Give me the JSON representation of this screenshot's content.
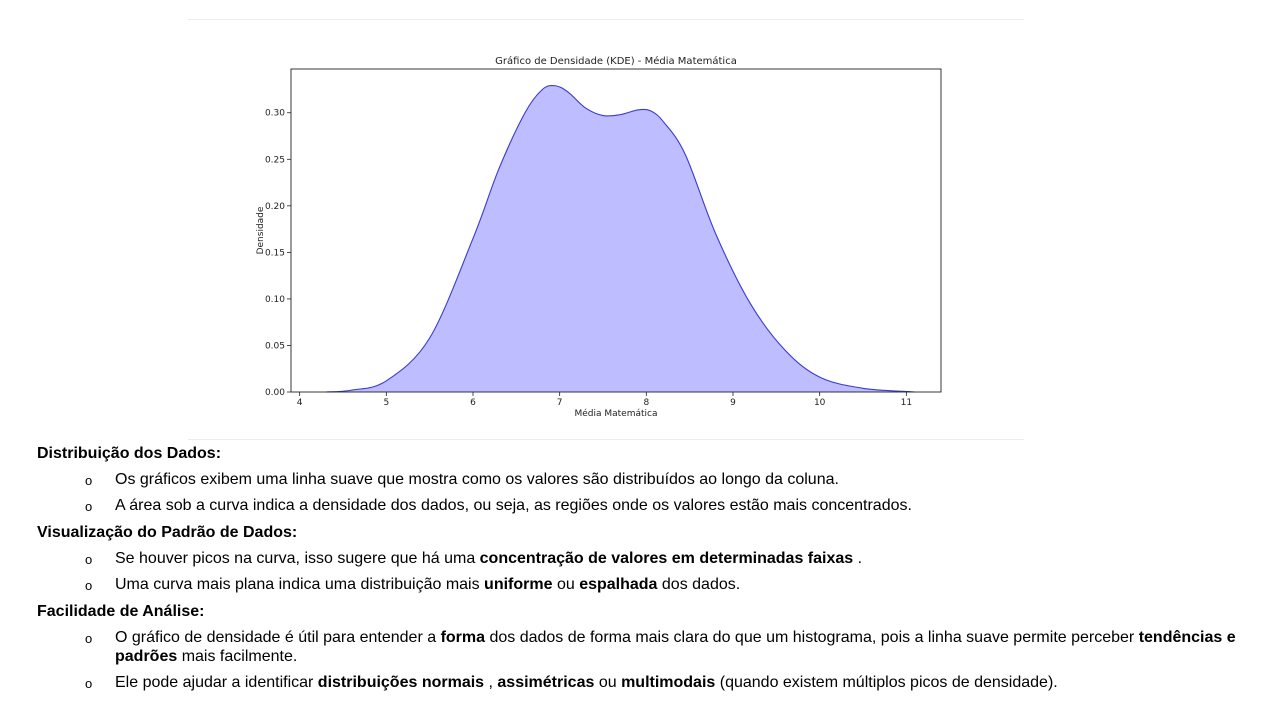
{
  "chart_data": {
    "type": "area",
    "title": "Gráfico de Densidade (KDE) - Média Matemática",
    "xlabel": "Média Matemática",
    "ylabel": "Densidade",
    "xlim": [
      3.9,
      11.4
    ],
    "ylim": [
      0,
      0.347
    ],
    "xticks": [
      "4",
      "5",
      "6",
      "7",
      "8",
      "9",
      "10",
      "11"
    ],
    "yticks": [
      "0.00",
      "0.05",
      "0.10",
      "0.15",
      "0.20",
      "0.25",
      "0.30"
    ],
    "x": [
      4.3,
      4.6,
      5.0,
      5.5,
      6.0,
      6.3,
      6.6,
      6.8,
      6.95,
      7.1,
      7.3,
      7.5,
      7.7,
      7.9,
      8.05,
      8.2,
      8.45,
      8.8,
      9.2,
      9.6,
      10.0,
      10.5,
      11.1
    ],
    "y": [
      0.0,
      0.002,
      0.012,
      0.058,
      0.165,
      0.24,
      0.3,
      0.325,
      0.329,
      0.322,
      0.305,
      0.297,
      0.298,
      0.303,
      0.302,
      0.29,
      0.255,
      0.17,
      0.095,
      0.045,
      0.016,
      0.004,
      0.0
    ],
    "fill_color": "#bdbdff",
    "line_color": "#3a3ad0",
    "grid": false
  },
  "sections": [
    {
      "title": "Distribuição dos Dados:",
      "bullets": [
        [
          {
            "t": "Os gráficos exibem uma linha suave que mostra como os valores são distribuídos ao longo da coluna."
          }
        ],
        [
          {
            "t": "A área sob a curva indica a densidade dos dados, ou seja, as regiões onde os valores estão mais concentrados."
          }
        ]
      ]
    },
    {
      "title": "Visualização do Padrão de Dados:",
      "bullets": [
        [
          {
            "t": "Se houver picos na curva, isso sugere que há uma "
          },
          {
            "t": "concentração de valores em determinadas faixas",
            "b": true
          },
          {
            "t": " ."
          }
        ],
        [
          {
            "t": "Uma curva mais plana indica uma distribuição mais "
          },
          {
            "t": "uniforme",
            "b": true
          },
          {
            "t": " ou "
          },
          {
            "t": "espalhada",
            "b": true
          },
          {
            "t": " dos dados."
          }
        ]
      ]
    },
    {
      "title": "Facilidade de Análise:",
      "bullets": [
        [
          {
            "t": "O gráfico de densidade é útil para entender a "
          },
          {
            "t": "forma",
            "b": true
          },
          {
            "t": " dos dados de forma mais clara do que um histograma, pois a linha suave permite perceber "
          },
          {
            "t": "tendências e padrões",
            "b": true
          },
          {
            "t": " mais facilmente."
          }
        ],
        [
          {
            "t": "Ele pode ajudar a identificar "
          },
          {
            "t": "distribuições normais",
            "b": true
          },
          {
            "t": " , "
          },
          {
            "t": "assimétricas",
            "b": true
          },
          {
            "t": " ou "
          },
          {
            "t": "multimodais",
            "b": true
          },
          {
            "t": " (quando existem múltiplos picos de densidade)."
          }
        ]
      ]
    }
  ],
  "bullet_symbol": "o"
}
